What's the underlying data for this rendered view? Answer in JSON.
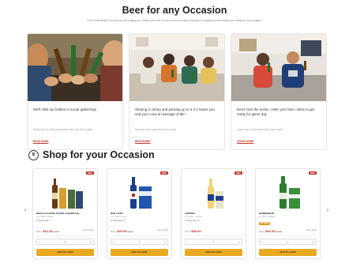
{
  "header": {
    "title": "Beer for any Occasion",
    "subtitle": "From celebrating to cheering to just hanging out. Gather your beer and your crew and enjoy big sales by packing up and loading your fridge for any occasion."
  },
  "occasions": [
    {
      "heading": "We'll clink our bottles to social gatherings",
      "sub": "Read more on why you should order your beer online",
      "link": "READ MORE"
    },
    {
      "heading": "Sharing is caring and packing up to a 2-4 saves you and your crew an average of $9.*",
      "sub": "Discover more ways that one to save",
      "link": "READ MORE"
    },
    {
      "heading": "Don't miss the action, order your beer online to get ready for game day",
      "sub": "Learn how to order beer from your couch",
      "link": "LEARN MORE"
    }
  ],
  "shop": {
    "icon_text": "B",
    "title": "Shop for your Occasion"
  },
  "nav": {
    "prev": "‹",
    "next": "›"
  },
  "products": [
    {
      "badge": "NEW",
      "name": "BEAU'S CLASSIC PACKS LAGERS ALE",
      "meta": "12 x 355 mL Bottle",
      "stock": "In Stock Now: 7",
      "sale_tag": "",
      "price_label": "Price:",
      "price": "$32.29",
      "old_price": "$34.99",
      "save": "Save: $2.70",
      "qty": "1",
      "button": "ADD TO CART"
    },
    {
      "badge": "NEW",
      "name": "BUD LIGHT",
      "meta": "24 x 355 mL Cans",
      "stock": "In Stock Now: 9",
      "sale_tag": "",
      "price_label": "Price:",
      "price": "$45.99",
      "old_price": "$48.99",
      "save": "Save: $3.00",
      "qty": "1",
      "button": "ADD TO CART"
    },
    {
      "badge": "NEW",
      "name": "CORONA",
      "meta": "12 x 330 mL Bottle",
      "stock": "In Stock Now: 9",
      "sale_tag": "",
      "price_label": "Price:",
      "price": "$58.09",
      "old_price": "",
      "save": "",
      "qty": "1",
      "button": "ADD TO CART"
    },
    {
      "badge": "NEW",
      "name": "HEINEKEN 6X",
      "meta": "6 x 330 mL Bottle",
      "stock": "",
      "sale_tag": "ON SALE",
      "price_label": "Price:",
      "price": "$54.49",
      "old_price": "$57.99",
      "save": "Save: $3.50",
      "qty": "1",
      "button": "ADD TO CART"
    }
  ]
}
